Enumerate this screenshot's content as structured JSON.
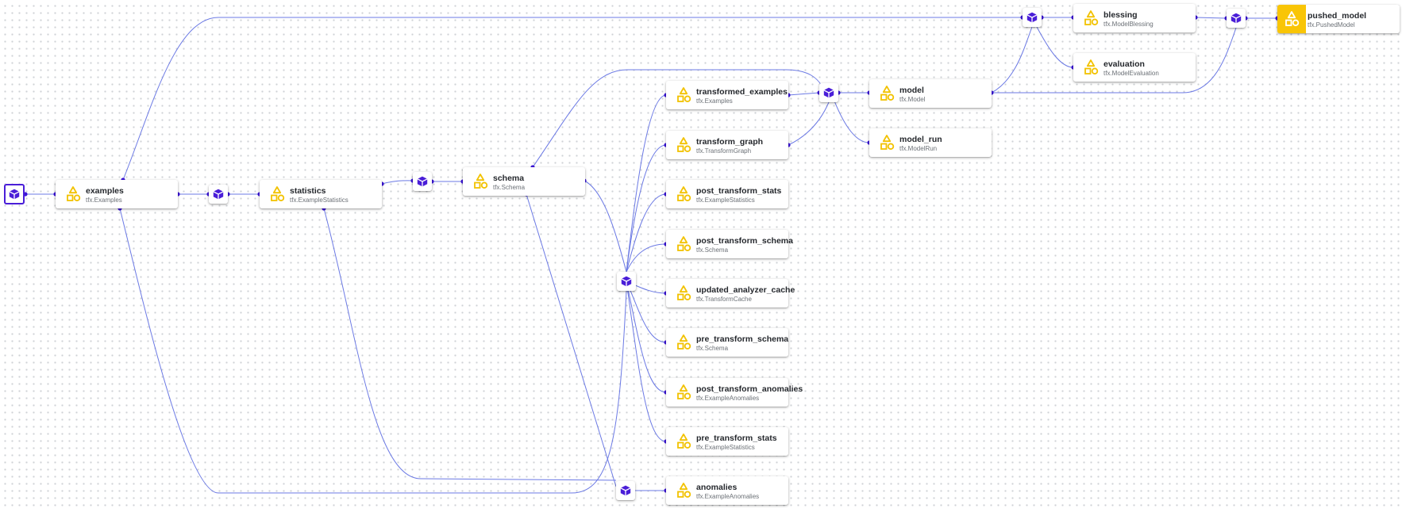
{
  "colors": {
    "edge": "#6b79e4",
    "port": "#3d16d8",
    "execution_icon": "#4a1ed8",
    "artifact_icon": "#f2c200",
    "highlight": "#f9c506"
  },
  "artifacts": {
    "examples": {
      "name": "examples",
      "type": "tfx.Examples",
      "icon": "artifact-shapes-icon"
    },
    "statistics": {
      "name": "statistics",
      "type": "tfx.ExampleStatistics",
      "icon": "artifact-shapes-icon"
    },
    "schema": {
      "name": "schema",
      "type": "tfx.Schema",
      "icon": "artifact-shapes-icon"
    },
    "transformed_examples": {
      "name": "transformed_examples",
      "type": "tfx.Examples",
      "icon": "artifact-shapes-icon"
    },
    "transform_graph": {
      "name": "transform_graph",
      "type": "tfx.TransformGraph",
      "icon": "artifact-shapes-icon"
    },
    "post_transform_stats": {
      "name": "post_transform_stats",
      "type": "tfx.ExampleStatistics",
      "icon": "artifact-shapes-icon"
    },
    "post_transform_schema": {
      "name": "post_transform_schema",
      "type": "tfx.Schema",
      "icon": "artifact-shapes-icon"
    },
    "updated_analyzer_cache": {
      "name": "updated_analyzer_cache",
      "type": "tfx.TransformCache",
      "icon": "artifact-shapes-icon"
    },
    "pre_transform_schema": {
      "name": "pre_transform_schema",
      "type": "tfx.Schema",
      "icon": "artifact-shapes-icon"
    },
    "post_transform_anomalies": {
      "name": "post_transform_anomalies",
      "type": "tfx.ExampleAnomalies",
      "icon": "artifact-shapes-icon"
    },
    "pre_transform_stats": {
      "name": "pre_transform_stats",
      "type": "tfx.ExampleStatistics",
      "icon": "artifact-shapes-icon"
    },
    "anomalies": {
      "name": "anomalies",
      "type": "tfx.ExampleAnomalies",
      "icon": "artifact-shapes-icon"
    },
    "model": {
      "name": "model",
      "type": "tfx.Model",
      "icon": "artifact-shapes-icon"
    },
    "model_run": {
      "name": "model_run",
      "type": "tfx.ModelRun",
      "icon": "artifact-shapes-icon"
    },
    "blessing": {
      "name": "blessing",
      "type": "tfx.ModelBlessing",
      "icon": "artifact-shapes-icon"
    },
    "evaluation": {
      "name": "evaluation",
      "type": "tfx.ModelEvaluation",
      "icon": "artifact-shapes-icon"
    },
    "pushed_model": {
      "name": "pushed_model",
      "type": "tfx.PushedModel",
      "icon": "artifact-shapes-icon",
      "highlighted": true
    }
  },
  "executions": {
    "icon": "execution-cube-icon",
    "selected": "example-gen"
  }
}
